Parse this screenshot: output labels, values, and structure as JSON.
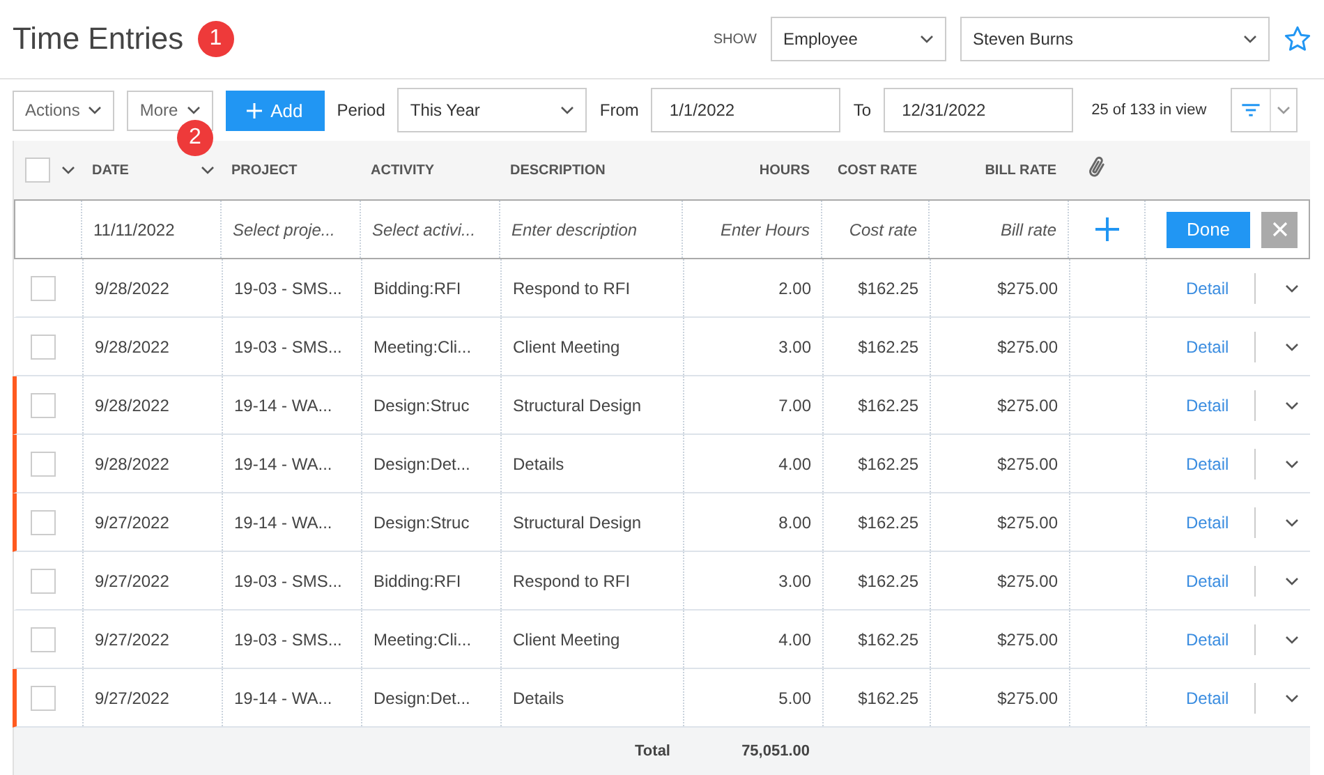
{
  "header": {
    "title": "Time Entries",
    "badge": "1",
    "show_label": "SHOW",
    "show_by": "Employee",
    "employee": "Steven Burns"
  },
  "toolbar": {
    "actions": "Actions",
    "more": "More",
    "badge": "2",
    "add": "Add",
    "period_label": "Period",
    "period": "This Year",
    "from_label": "From",
    "from": "1/1/2022",
    "to_label": "To",
    "to": "12/31/2022",
    "count": "25 of 133 in view"
  },
  "table": {
    "select_all": {
      "checked": false
    },
    "columns": [
      "DATE",
      "PROJECT",
      "ACTIVITY",
      "DESCRIPTION",
      "HOURS",
      "COST RATE",
      "BILL RATE"
    ],
    "new_entry": {
      "date": "11/11/2022",
      "project": {
        "placeholder": "Select proje..."
      },
      "activity": {
        "placeholder": "Select activi..."
      },
      "description": {
        "placeholder": "Enter description"
      },
      "hours": {
        "placeholder": "Enter Hours"
      },
      "cost_rate": {
        "placeholder": "Cost rate"
      },
      "bill_rate": {
        "placeholder": "Bill rate"
      },
      "done": "Done"
    },
    "rows": [
      {
        "date": "9/28/2022",
        "project": "19-03 - SMS...",
        "activity": "Bidding:RFI",
        "description": "Respond to RFI",
        "hours": "2.00",
        "cost_rate": "$162.25",
        "bill_rate": "$275.00",
        "detail": "Detail",
        "flagged": false,
        "checked": false
      },
      {
        "date": "9/28/2022",
        "project": "19-03 - SMS...",
        "activity": "Meeting:Cli...",
        "description": "Client Meeting",
        "hours": "3.00",
        "cost_rate": "$162.25",
        "bill_rate": "$275.00",
        "detail": "Detail",
        "flagged": false,
        "checked": false
      },
      {
        "date": "9/28/2022",
        "project": "19-14 - WA...",
        "activity": "Design:Struc",
        "description": "Structural Design",
        "hours": "7.00",
        "cost_rate": "$162.25",
        "bill_rate": "$275.00",
        "detail": "Detail",
        "flagged": true,
        "checked": false
      },
      {
        "date": "9/28/2022",
        "project": "19-14 - WA...",
        "activity": "Design:Det...",
        "description": "Details",
        "hours": "4.00",
        "cost_rate": "$162.25",
        "bill_rate": "$275.00",
        "detail": "Detail",
        "flagged": true,
        "checked": false
      },
      {
        "date": "9/27/2022",
        "project": "19-14 - WA...",
        "activity": "Design:Struc",
        "description": "Structural Design",
        "hours": "8.00",
        "cost_rate": "$162.25",
        "bill_rate": "$275.00",
        "detail": "Detail",
        "flagged": true,
        "checked": false
      },
      {
        "date": "9/27/2022",
        "project": "19-03 - SMS...",
        "activity": "Bidding:RFI",
        "description": "Respond to RFI",
        "hours": "3.00",
        "cost_rate": "$162.25",
        "bill_rate": "$275.00",
        "detail": "Detail",
        "flagged": false,
        "checked": false
      },
      {
        "date": "9/27/2022",
        "project": "19-03 - SMS...",
        "activity": "Meeting:Cli...",
        "description": "Client Meeting",
        "hours": "4.00",
        "cost_rate": "$162.25",
        "bill_rate": "$275.00",
        "detail": "Detail",
        "flagged": false,
        "checked": false
      },
      {
        "date": "9/27/2022",
        "project": "19-14 - WA...",
        "activity": "Design:Det...",
        "description": "Details",
        "hours": "5.00",
        "cost_rate": "$162.25",
        "bill_rate": "$275.00",
        "detail": "Detail",
        "flagged": true,
        "checked": false
      }
    ],
    "total": {
      "label": "Total",
      "hours": "75,051.00"
    }
  }
}
